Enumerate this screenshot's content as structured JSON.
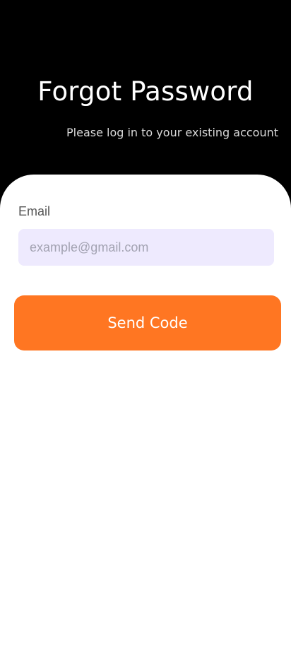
{
  "header": {
    "title": "Forgot Password",
    "subtitle": "Please log in to your existing account"
  },
  "form": {
    "email_label": "Email",
    "email_placeholder": "example@gmail.com",
    "email_value": "",
    "send_button_label": "Send Code"
  },
  "colors": {
    "background": "#000000",
    "sheet": "#FFFFFF",
    "input_background": "#EEEAFE",
    "accent": "#FF7622"
  }
}
